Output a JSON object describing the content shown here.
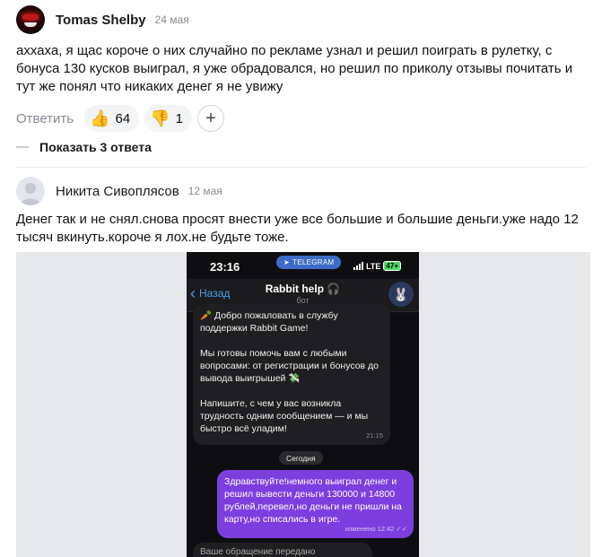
{
  "comments": [
    {
      "author": "Tomas Shelby",
      "date": "24 мая",
      "text": "аххаха, я щас короче о них случайно по рекламе узнал и решил поиграть в рулетку, с бонуса 130 кусков выиграл, я уже обрадовался, но решил по приколу отзывы почитать и тут же понял что никаких денег я не увижу",
      "reply_label": "Ответить",
      "reactions": [
        {
          "icon": "thumbs-up",
          "emoji": "👍",
          "count": "64"
        },
        {
          "icon": "thumbs-down",
          "emoji": "👎",
          "count": "1"
        }
      ],
      "add_reaction": "+"
    },
    {
      "author": "Никита Сивоплясов",
      "date": "12 мая",
      "text": "Денег так и не снял.снова просят внести уже все большие и большие деньги.уже надо 12 тысяч вкинуть.короче я лох.не будьте тоже."
    }
  ],
  "show_replies": "Показать 3 ответа",
  "screenshot": {
    "status_time": "23:16",
    "telegram_label": "TELEGRAM",
    "network": "LTE",
    "battery": "47+",
    "back_label": "Назад",
    "chat_title": "Rabbit help 🎧",
    "chat_subtitle": "бот",
    "bot_message": [
      "🥕 Добро пожаловать в службу поддержки Rabbit Game!",
      "Мы готовы помочь вам с любыми вопросами: от регистрации и бонусов до вывода выигрышей 💸",
      "Напишите, с чем у вас возникла трудность одним сообщением — и мы быстро всё уладим!"
    ],
    "bot_time": "21:15",
    "day_separator": "Сегодня",
    "user_message": "Здравствуйте!немного выиграл денег и решил вывести деньги 130000 и 14800 рублей,перевел,но деньги не пришли на карту,но списались в игре.",
    "user_time": "изменено 12:42 ✓✓",
    "next_message_partial": "Ваше обращение передано"
  },
  "colors": {
    "accent_purple": "#7d3ee0",
    "telegram_blue": "#4a9ef0",
    "muted": "#858a93"
  }
}
